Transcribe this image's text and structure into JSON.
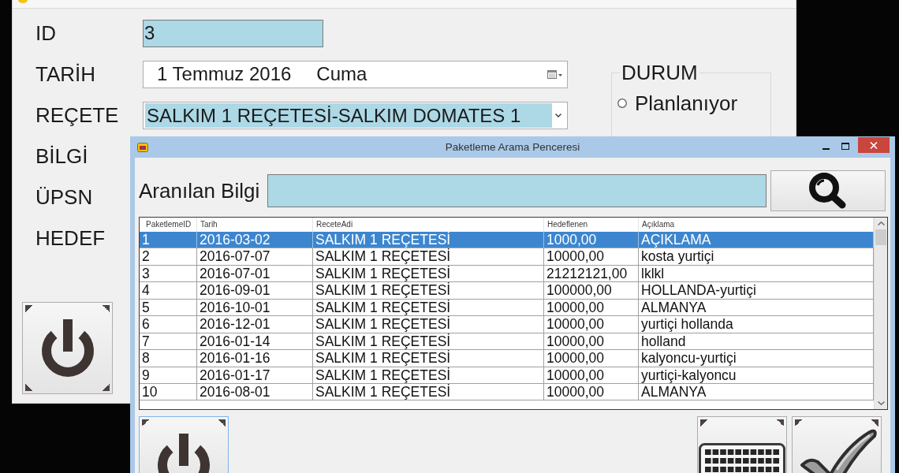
{
  "background_window": {
    "form_rows": [
      {
        "label": "ID",
        "kind": "text",
        "value": "3"
      },
      {
        "label": "TARİH",
        "kind": "date",
        "value": "1 Temmuz 2016",
        "day": "Cuma"
      },
      {
        "label": "REÇETE",
        "kind": "combo",
        "value": "SALKIM 1 REÇETESİ-SALKIM DOMATES 1"
      },
      {
        "label": "BİLGİ",
        "kind": "covered"
      },
      {
        "label": "ÜPSN",
        "kind": "covered"
      },
      {
        "label": "HEDEF",
        "kind": "covered"
      }
    ],
    "status_group": {
      "title": "DURUM",
      "options": [
        {
          "label": "Planlanıyor",
          "selected": false
        }
      ]
    },
    "buttons": [
      {
        "kind": "power",
        "focused": false
      }
    ]
  },
  "search_window": {
    "title": "Paketleme Arama Penceresi",
    "search": {
      "label": "Aranılan Bilgi"
    },
    "table": {
      "columns": [
        "PaketlemeID",
        "Tarih",
        "ReceteAdi",
        "Hedeflenen",
        "Açıklama"
      ],
      "rows": [
        {
          "cells": [
            "1",
            "2016-03-02",
            "SALKIM 1 REÇETESİ",
            "1000,00",
            "AÇIKLAMA"
          ],
          "selected": true
        },
        {
          "cells": [
            "2",
            "2016-07-07",
            "SALKIM 1 REÇETESİ",
            "10000,00",
            "kosta yurtiçi"
          ],
          "selected": false
        },
        {
          "cells": [
            "3",
            "2016-07-01",
            "SALKIM 1 REÇETESİ",
            "21212121,00",
            "lklkl"
          ],
          "selected": false
        },
        {
          "cells": [
            "4",
            "2016-09-01",
            "SALKIM 1 REÇETESİ",
            "100000,00",
            "HOLLANDA-yurtiçi"
          ],
          "selected": false
        },
        {
          "cells": [
            "5",
            "2016-10-01",
            "SALKIM 1 REÇETESİ",
            "10000,00",
            "ALMANYA"
          ],
          "selected": false
        },
        {
          "cells": [
            "6",
            "2016-12-01",
            "SALKIM 1 REÇETESİ",
            "10000,00",
            "yurtiçi hollanda"
          ],
          "selected": false
        },
        {
          "cells": [
            "7",
            "2016-01-14",
            "SALKIM 1 REÇETESİ",
            "10000,00",
            "holland"
          ],
          "selected": false
        },
        {
          "cells": [
            "8",
            "2016-01-16",
            "SALKIM 1 REÇETESİ",
            "10000,00",
            "kalyoncu-yurtiçi"
          ],
          "selected": false
        },
        {
          "cells": [
            "9",
            "2016-01-17",
            "SALKIM 1 REÇETESİ",
            "10000,00",
            "yurtiçi-kalyoncu"
          ],
          "selected": false
        },
        {
          "cells": [
            "10",
            "2016-08-01",
            "SALKIM 1 REÇETESİ",
            "10000,00",
            "ALMANYA"
          ],
          "selected": false
        }
      ]
    },
    "buttons": [
      {
        "kind": "power",
        "focused": true
      },
      {
        "kind": "keyboard",
        "focused": false
      },
      {
        "kind": "check",
        "focused": false
      }
    ]
  }
}
